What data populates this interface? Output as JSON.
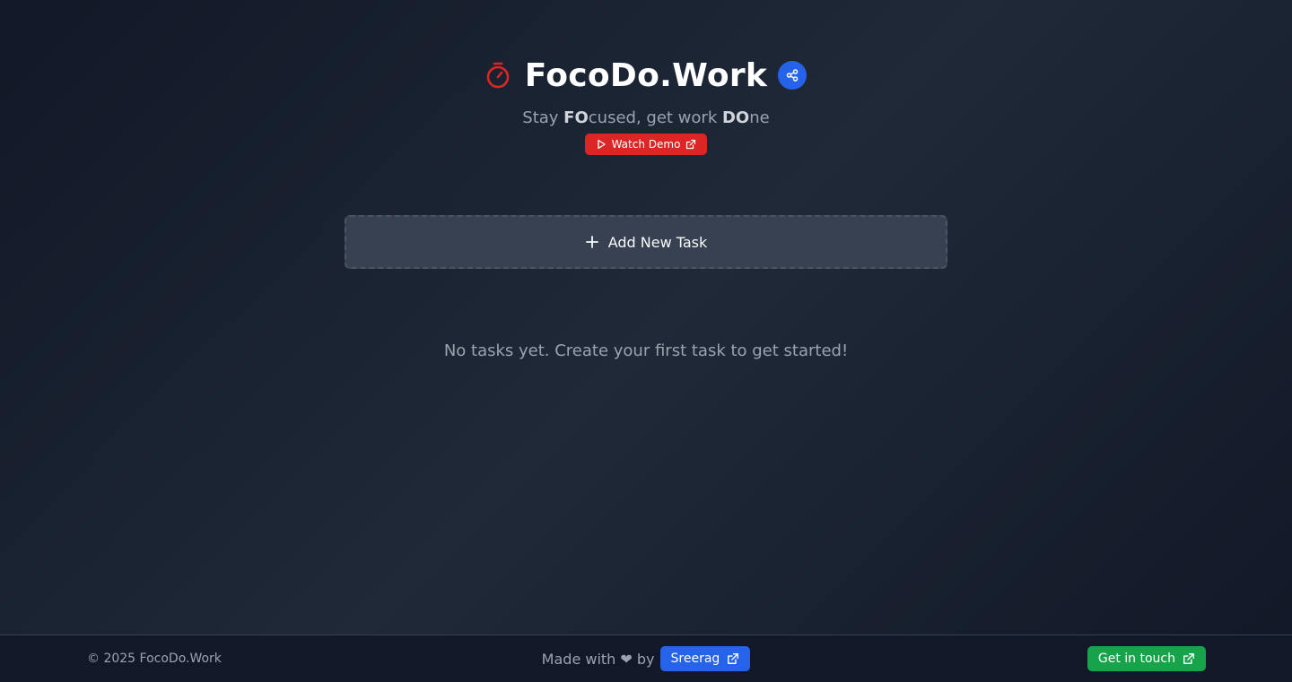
{
  "header": {
    "title": "FocoDo.Work",
    "tagline": {
      "part1": "Stay ",
      "bold1": "FO",
      "part2": "cused, get work ",
      "bold2": "DO",
      "part3": "ne"
    },
    "demo_label": "Watch Demo",
    "timer_icon": "timer-icon",
    "share_icon": "share-icon"
  },
  "main": {
    "add_task_label": "Add New Task",
    "empty_message": "No tasks yet. Create your first task to get started!"
  },
  "footer": {
    "copyright": "© 2025 FocoDo.Work",
    "made_with": "Made with ❤ by",
    "author": "Sreerag",
    "contact": "Get in touch"
  },
  "colors": {
    "accent_red": "#dc2626",
    "accent_blue": "#2563eb",
    "accent_green": "#16a34a",
    "background": "#1f2937"
  }
}
